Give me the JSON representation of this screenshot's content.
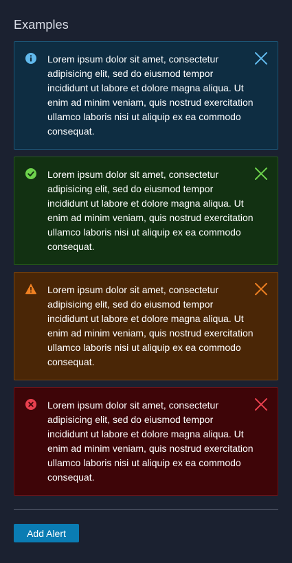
{
  "section": {
    "title": "Examples"
  },
  "alerts": [
    {
      "type": "info",
      "icon": "info-icon",
      "text": "Lorem ipsum dolor sit amet, consectetur adipisicing elit, sed do eiusmod tempor incididunt ut labore et dolore magna aliqua. Ut enim ad minim veniam, quis nostrud exercitation ullamco laboris nisi ut aliquip ex ea commodo consequat.",
      "accent_color": "#61b9ec"
    },
    {
      "type": "success",
      "icon": "check-circle-icon",
      "text": "Lorem ipsum dolor sit amet, consectetur adipisicing elit, sed do eiusmod tempor incididunt ut labore et dolore magna aliqua. Ut enim ad minim veniam, quis nostrud exercitation ullamco laboris nisi ut aliquip ex ea commodo consequat.",
      "accent_color": "#6ed34d"
    },
    {
      "type": "warning",
      "icon": "warning-triangle-icon",
      "text": "Lorem ipsum dolor sit amet, consectetur adipisicing elit, sed do eiusmod tempor incididunt ut labore et dolore magna aliqua. Ut enim ad minim veniam, quis nostrud exercitation ullamco laboris nisi ut aliquip ex ea commodo consequat.",
      "accent_color": "#f08122"
    },
    {
      "type": "danger",
      "icon": "error-circle-icon",
      "text": "Lorem ipsum dolor sit amet, consectetur adipisicing elit, sed do eiusmod tempor incididunt ut labore et dolore magna aliqua. Ut enim ad minim veniam, quis nostrud exercitation ullamco laboris nisi ut aliquip ex ea commodo consequat.",
      "accent_color": "#e8404e"
    }
  ],
  "actions": {
    "add_label": "Add Alert",
    "add_color": "#0a7cb3"
  }
}
